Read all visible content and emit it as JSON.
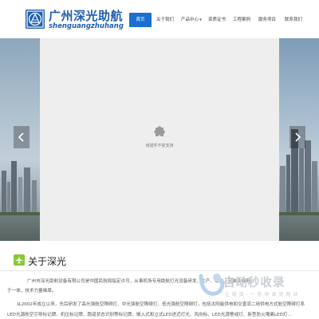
{
  "header": {
    "logo_cn": "广州深光助航",
    "logo_pinyin": "shenguangzhuhang",
    "nav": [
      {
        "label": "首页",
        "active": true,
        "has_caret": false
      },
      {
        "label": "关于我们",
        "active": false,
        "has_caret": false
      },
      {
        "label": "产品中心",
        "active": false,
        "has_caret": true
      },
      {
        "label": "资质证书",
        "active": false,
        "has_caret": false
      },
      {
        "label": "工程案例",
        "active": false,
        "has_caret": false
      },
      {
        "label": "服务项目",
        "active": false,
        "has_caret": false
      },
      {
        "label": "联系我们",
        "active": false,
        "has_caret": false
      }
    ],
    "brand_color": "#1e5fb0",
    "active_color": "#1a6fd0"
  },
  "slider": {
    "plugin_message": "该插件不受支持",
    "plugin_icon": "puzzle-piece-icon",
    "prev_icon": "chevron-left-icon",
    "next_icon": "chevron-right-icon"
  },
  "about": {
    "title": "关于深光",
    "title_icon": "airplane-icon",
    "accent_color": "#8cc63f",
    "paragraphs": [
      "广州市深光助航设备有限公司是中国民航局指定许可，从事机场专用助航灯光设备研发、生产、销售、安装及服务",
      "于一体，技术力量雄厚。",
      "从2002年成立以来，先后研发了高光强航空障碍灯、中光强航空障碍灯、低光强航空障碍灯，包括太阳能供电和交直流二用供电方式航空障碍灯系",
      "LED光源航空引导标记牌、机位标记牌、跑道状态识别等标记牌、嵌入式和立式LED进近灯光、风向标、LED光源警戒灯、新型防火隔离LED灯..."
    ]
  },
  "watermark": {
    "text": "自动秒收录",
    "subtext": "让 链 接 - 一 秒 收 录 到 网 站"
  }
}
